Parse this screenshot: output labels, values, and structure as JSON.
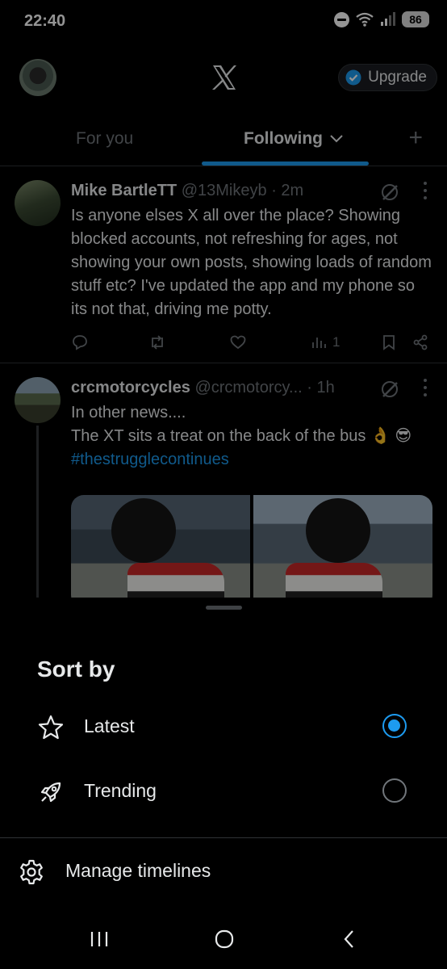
{
  "status_bar": {
    "time": "22:40",
    "battery": "86"
  },
  "header": {
    "upgrade_label": "Upgrade"
  },
  "tabs": {
    "for_you": "For you",
    "following": "Following",
    "add": "+"
  },
  "posts": [
    {
      "name": "Mike BartleTT",
      "handle": "@13Mikeyb",
      "time": "· 2m",
      "text": "Is anyone elses X all over the place? Showing blocked accounts, not refreshing for ages, not showing your own posts, showing loads of random stuff etc? I've updated the app and my phone so its not that, driving me potty.",
      "views": "1"
    },
    {
      "name": "crcmotorcycles",
      "handle": "@crcmotorcy...",
      "time": "· 1h",
      "text_line1": "In other news....",
      "text_line2": "The XT sits a treat on the back of the bus 👌 😎",
      "hashtag": "#thestrugglecontinues"
    }
  ],
  "sort_sheet": {
    "title": "Sort by",
    "options": [
      {
        "label": "Latest",
        "icon": "star-icon",
        "selected": true
      },
      {
        "label": "Trending",
        "icon": "rocket-icon",
        "selected": false
      }
    ],
    "manage_label": "Manage timelines"
  },
  "colors": {
    "accent": "#1d9bf0",
    "background": "#000000",
    "muted": "#71767b"
  }
}
